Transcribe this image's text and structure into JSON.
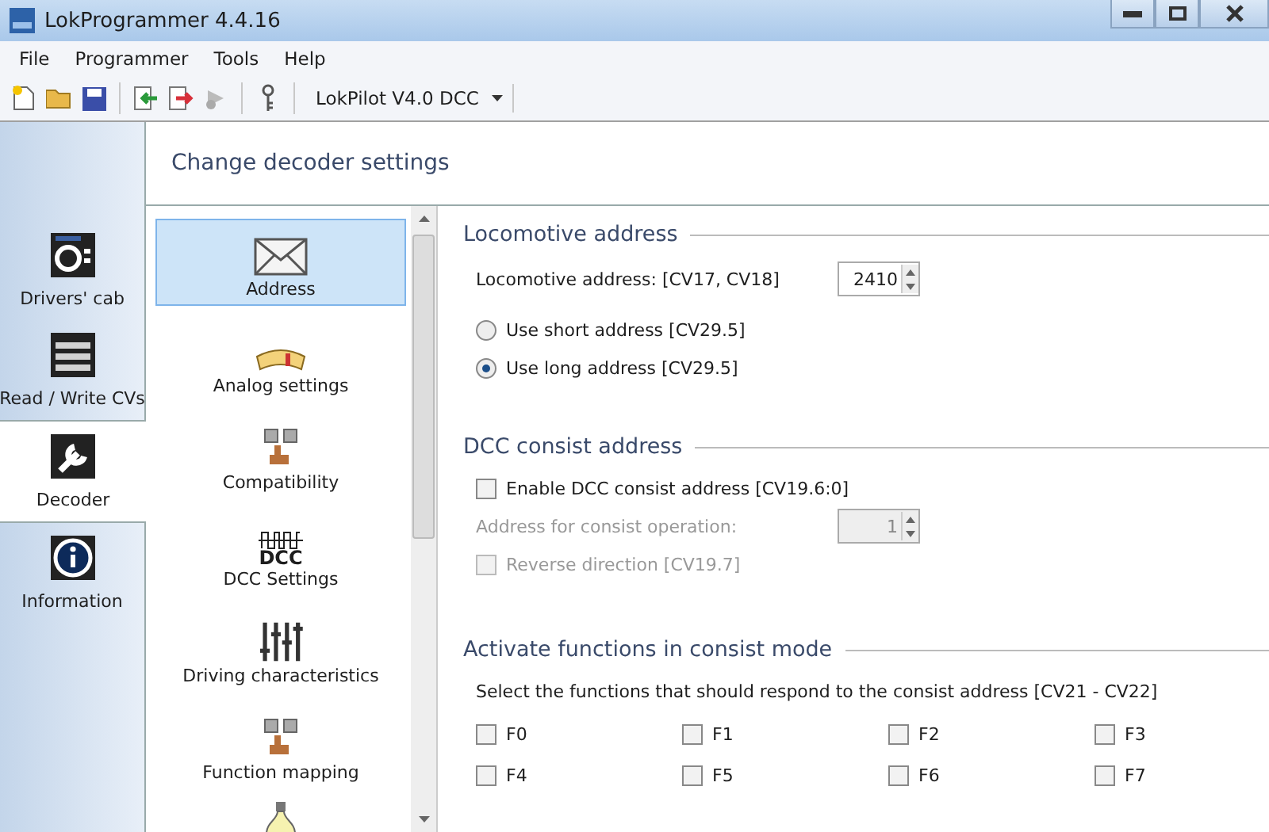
{
  "window": {
    "title": "LokProgrammer 4.4.16"
  },
  "menu": [
    "File",
    "Programmer",
    "Tools",
    "Help"
  ],
  "toolbar": {
    "decoder": "LokPilot V4.0 DCC"
  },
  "nav": [
    {
      "label": "Drivers' cab",
      "kind": "cab",
      "selected": false
    },
    {
      "label": "Read / Write CVs",
      "kind": "cv",
      "selected": false
    },
    {
      "label": "Decoder",
      "kind": "decoder",
      "selected": true
    },
    {
      "label": "Information",
      "kind": "info",
      "selected": false
    }
  ],
  "header": "Change decoder settings",
  "categories": [
    {
      "label": "Address",
      "kind": "envelope",
      "selected": true
    },
    {
      "label": "Analog settings",
      "kind": "gauge",
      "selected": false
    },
    {
      "label": "Compatibility",
      "kind": "keys",
      "selected": false
    },
    {
      "label": "DCC Settings",
      "kind": "dcc",
      "icon_text": "DCC",
      "selected": false
    },
    {
      "label": "Driving characteristics",
      "kind": "sliders",
      "selected": false
    },
    {
      "label": "Function mapping",
      "kind": "keys",
      "selected": false
    },
    {
      "kind": "bulb",
      "selected": false
    }
  ],
  "loco_address": {
    "title": "Locomotive address",
    "label": "Locomotive address: [CV17, CV18]",
    "value": "2410",
    "options": [
      {
        "label": "Use short address [CV29.5]",
        "selected": false
      },
      {
        "label": "Use long address [CV29.5]",
        "selected": true
      }
    ]
  },
  "consist": {
    "title": "DCC consist address",
    "enable": {
      "label": "Enable DCC consist address [CV19.6:0]",
      "checked": false
    },
    "address_label": "Address for consist operation:",
    "address_value": "1",
    "disabled": true,
    "reverse": {
      "label": "Reverse direction [CV19.7]",
      "checked": false
    }
  },
  "functions": {
    "title": "Activate functions in consist mode",
    "hint": "Select the functions that should respond to the consist address [CV21 - CV22]",
    "items": [
      {
        "label": "F0",
        "checked": false
      },
      {
        "label": "F1",
        "checked": false
      },
      {
        "label": "F2",
        "checked": false
      },
      {
        "label": "F3",
        "checked": false
      },
      {
        "label": "F4",
        "checked": false
      },
      {
        "label": "F5",
        "checked": false
      },
      {
        "label": "F6",
        "checked": false
      },
      {
        "label": "F7",
        "checked": false
      }
    ]
  }
}
